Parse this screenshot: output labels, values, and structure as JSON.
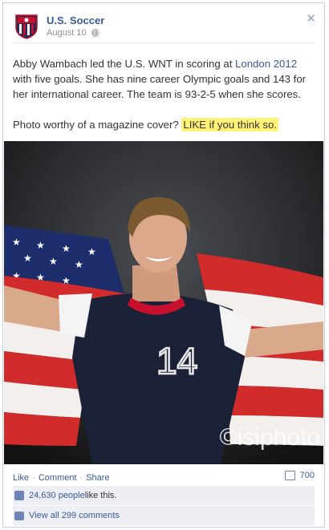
{
  "post": {
    "page_name": "U.S. Soccer",
    "date": "August 10",
    "body_part1": "Abby Wambach led the U.S. WNT in scoring at ",
    "body_link": "London 2012",
    "body_part2": " with five goals. She has nine career Olympic goals and 143 for her international career. The team is 93-2-5 when she scores.",
    "body2_text": "Photo worthy of a magazine cover? ",
    "body2_highlight": "LIKE if you think so.",
    "photo_watermark": "©isiphoto",
    "jersey_number": "14"
  },
  "actions": {
    "like": "Like",
    "comment": "Comment",
    "share": "Share",
    "comment_count": "700"
  },
  "feedback": {
    "likes_count": "24,630 people",
    "likes_suffix": " like this.",
    "view_comments": "View all 299 comments"
  },
  "colors": {
    "link": "#3b5998",
    "highlight": "#fff275",
    "feedback_bg": "#edeff4"
  }
}
